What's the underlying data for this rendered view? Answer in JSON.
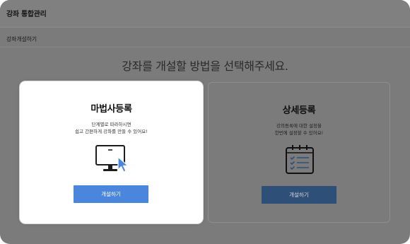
{
  "header": {
    "title": "강좌 통합관리"
  },
  "breadcrumb": {
    "label": "강좌개설하기"
  },
  "main": {
    "heading": "강좌를 개설할 방법을 선택해주세요.",
    "cards": [
      {
        "title": "마법사등록",
        "desc_line1": "단계별로 따라하시면",
        "desc_line2": "쉽고 간편하게 강좌를 만들 수 있어요!",
        "button_label": "개설하기",
        "icon": "monitor-cursor-icon"
      },
      {
        "title": "상세등록",
        "desc_line1": "강의등록에 대한 설정을",
        "desc_line2": "한번에 설정할 수 있어요!",
        "button_label": "개설하기",
        "icon": "checklist-icon"
      }
    ]
  },
  "colors": {
    "overlay": "#7b7b7b",
    "primary_button": "#4a86db",
    "dimmed_button": "#2e4f78"
  }
}
